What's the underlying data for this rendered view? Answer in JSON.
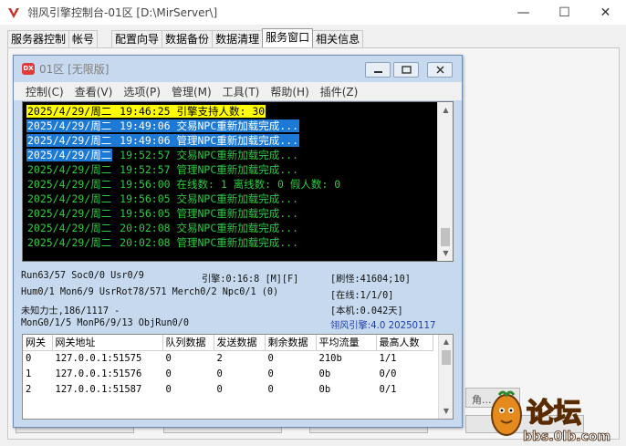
{
  "window": {
    "title": "翎风引擎控制台-01区 [D:\\MirServer\\]",
    "minimize_glyph": "—",
    "maximize_glyph": "☐",
    "close_glyph": "✕"
  },
  "tabs": [
    {
      "label": "服务器控制"
    },
    {
      "label": "帐号"
    },
    {
      "label": "配置向导"
    },
    {
      "label": "数据备份"
    },
    {
      "label": "数据清理"
    },
    {
      "label": "服务窗口"
    },
    {
      "label": "相关信息"
    }
  ],
  "background_item": {
    "label": "角..."
  },
  "child": {
    "icon_text": "DX",
    "title": "01区 [无限版]",
    "menu": [
      {
        "label": "控制(C)"
      },
      {
        "label": "查看(V)"
      },
      {
        "label": "选项(P)"
      },
      {
        "label": "管理(M)"
      },
      {
        "label": "工具(T)"
      },
      {
        "label": "帮助(H)"
      },
      {
        "label": "插件(Z)"
      }
    ],
    "console": [
      {
        "date": "2025/4/29/周二",
        "rest": " 19:46:25 引擎支持人数: 30",
        "date_bg": "#ffff00",
        "date_fg": "#000000",
        "rest_bg": "#ffff00",
        "rest_fg": "#000000"
      },
      {
        "date": "2025/4/29/周二",
        "rest": " 19:49:06 交易NPC重新加载完成...",
        "date_bg": "#1c7ad6",
        "date_fg": "#ffffff",
        "rest_bg": "#1c7ad6",
        "rest_fg": "#ffffff"
      },
      {
        "date": "2025/4/29/周二",
        "rest": " 19:49:06 管理NPC重新加载完成...",
        "date_bg": "#1c7ad6",
        "date_fg": "#ffffff",
        "rest_bg": "#1c7ad6",
        "rest_fg": "#ffffff"
      },
      {
        "date": "2025/4/29/周二",
        "rest": " 19:52:57 交易NPC重新加载完成...",
        "date_bg": "#1c7ad6",
        "date_fg": "#ffffff",
        "rest_bg": "transparent",
        "rest_fg": "#2ecc40"
      },
      {
        "date": "2025/4/29/周二",
        "rest": " 19:52:57 管理NPC重新加载完成...",
        "date_bg": "transparent",
        "date_fg": "#2ecc40",
        "rest_bg": "transparent",
        "rest_fg": "#2ecc40"
      },
      {
        "date": "2025/4/29/周二",
        "rest": " 19:56:00 在线数: 1 离线数: 0 假人数: 0",
        "date_bg": "transparent",
        "date_fg": "#2ecc40",
        "rest_bg": "transparent",
        "rest_fg": "#2ecc40"
      },
      {
        "date": "2025/4/29/周二",
        "rest": " 19:56:05 交易NPC重新加载完成...",
        "date_bg": "transparent",
        "date_fg": "#2ecc40",
        "rest_bg": "transparent",
        "rest_fg": "#2ecc40"
      },
      {
        "date": "2025/4/29/周二",
        "rest": " 19:56:05 管理NPC重新加载完成...",
        "date_bg": "transparent",
        "date_fg": "#2ecc40",
        "rest_bg": "transparent",
        "rest_fg": "#2ecc40"
      },
      {
        "date": "2025/4/29/周二",
        "rest": " 20:02:08 交易NPC重新加载完成...",
        "date_bg": "transparent",
        "date_fg": "#2ecc40",
        "rest_bg": "transparent",
        "rest_fg": "#2ecc40"
      },
      {
        "date": "2025/4/29/周二",
        "rest": " 20:02:08 管理NPC重新加载完成...",
        "date_bg": "transparent",
        "date_fg": "#2ecc40",
        "rest_bg": "transparent",
        "rest_fg": "#2ecc40"
      }
    ],
    "stats": {
      "run": "Run63/57 Soc0/0 Usr0/9",
      "engine": "引擎:0:16:8 [M][F]",
      "refresh": "[刷怪:41604;10]",
      "hum": "Hum0/1 Mon6/9 UsrRot78/571 Merch0/2 Npc0/1 (0)",
      "online": "[在线:1/1/0]",
      "unknown": "未知力士,186/1117 -",
      "local": "[本机:0.042天]",
      "mongo": "MonG0/1/5 MonP6/9/13 ObjRun0/0",
      "version": "翎风引擎:4.0 20250117"
    },
    "grid": {
      "headers": [
        "网关",
        "网关地址",
        "队列数据",
        "发送数据",
        "剩余数据",
        "平均流量",
        "最高人数"
      ],
      "rows": [
        [
          "0",
          "127.0.0.1:51575",
          "0",
          "2",
          "0",
          "210b",
          "1/1"
        ],
        [
          "1",
          "127.0.0.1:51576",
          "0",
          "0",
          "0",
          "0b",
          "0/0"
        ],
        [
          "2",
          "127.0.0.1:51587",
          "0",
          "0",
          "0",
          "0b",
          "0/1"
        ]
      ]
    }
  },
  "watermark": {
    "line1": "论坛",
    "line2": "bbs.0lb.com"
  }
}
